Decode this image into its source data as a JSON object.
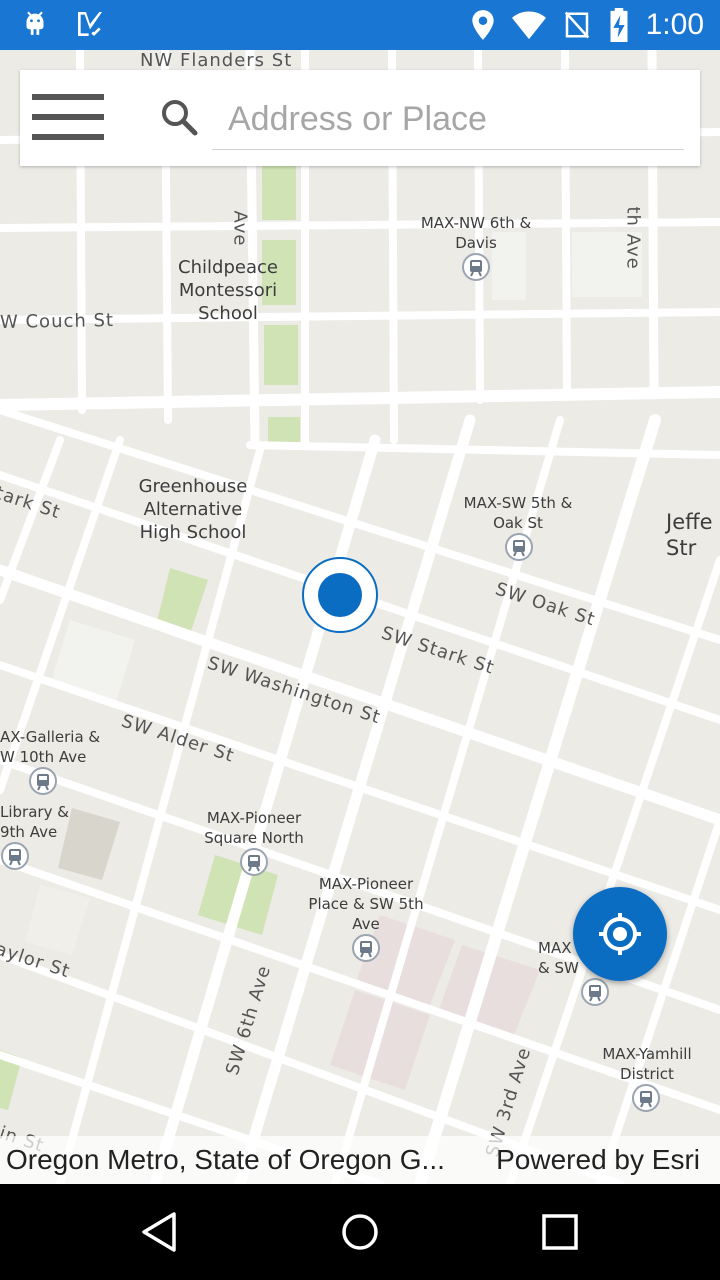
{
  "status_bar": {
    "time": "1:00",
    "left_icons": [
      "android-icon",
      "checklist-icon"
    ],
    "right_icons": [
      "location-pin-icon",
      "wifi-icon",
      "no-signal-icon",
      "battery-charging-icon"
    ]
  },
  "search": {
    "placeholder": "Address or Place",
    "value": ""
  },
  "map": {
    "street_labels": [
      "NW Flanders St",
      "W Couch St",
      "tark St",
      "SW Oak St",
      "SW Stark St",
      "SW Washington St",
      "SW Alder St",
      "aylor St",
      "SW 6th Ave",
      "SW 3rd Ave",
      "Ave",
      "th Ave",
      "in St"
    ],
    "places": [
      "Childpeace\nMontessori\nSchool",
      "Greenhouse\nAlternative\nHigh School",
      "Jeffe\nStr"
    ],
    "stations": [
      "MAX-NW 6th &\nDavis",
      "MAX-SW 5th &\nOak St",
      "AX-Galleria &\nW 10th Ave",
      "Library &\n9th Ave",
      "MAX-Pioneer\nSquare North",
      "MAX-Pioneer\nPlace & SW 5th\nAve",
      "MAX\n& SW",
      "MAX-Yamhill\nDistrict"
    ],
    "colors": {
      "background": "#ecebe6",
      "road": "#ffffff",
      "park": "#cfe3b4",
      "plaza": "#e8dede",
      "accent": "#0a6dc2"
    }
  },
  "attribution": {
    "source": "Oregon Metro, State of Oregon G...",
    "powered_by": "Powered by Esri"
  },
  "nav_bar": {
    "icons": [
      "back-icon",
      "home-icon",
      "recents-icon"
    ]
  }
}
